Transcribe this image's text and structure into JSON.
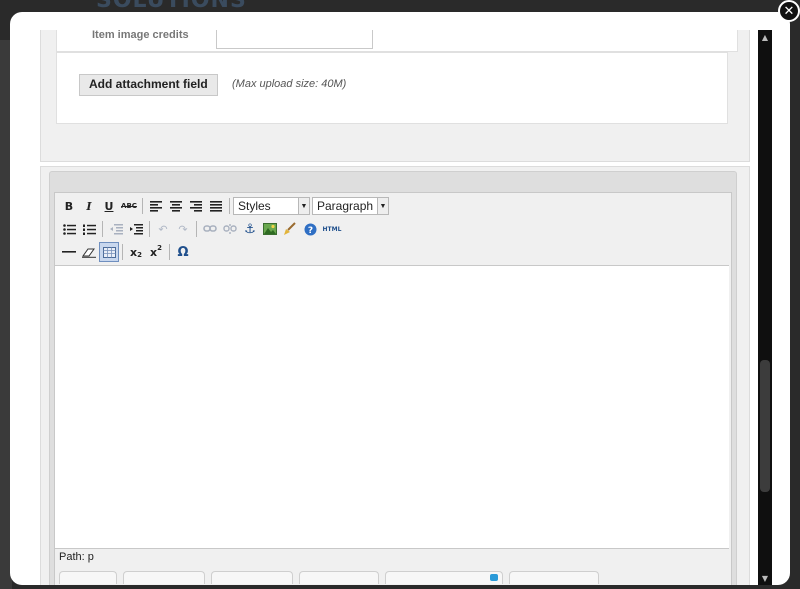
{
  "background": {
    "logo_text": "SOLUTIONS"
  },
  "modal": {
    "close_icon": "close-icon"
  },
  "form": {
    "credits_label": "Item image credits",
    "add_attachment_label": "Add attachment field",
    "max_upload_note": "(Max upload size: 40M)"
  },
  "editor": {
    "toolbar": {
      "styles_select": "Styles",
      "format_select": "Paragraph",
      "html_label": "HTML",
      "special_char": "Ω"
    },
    "path_label": "Path: p"
  },
  "colors": {
    "accent": "#2a9ad8",
    "modal_bg": "#ffffff",
    "panel_bg": "#f0f0f0"
  }
}
